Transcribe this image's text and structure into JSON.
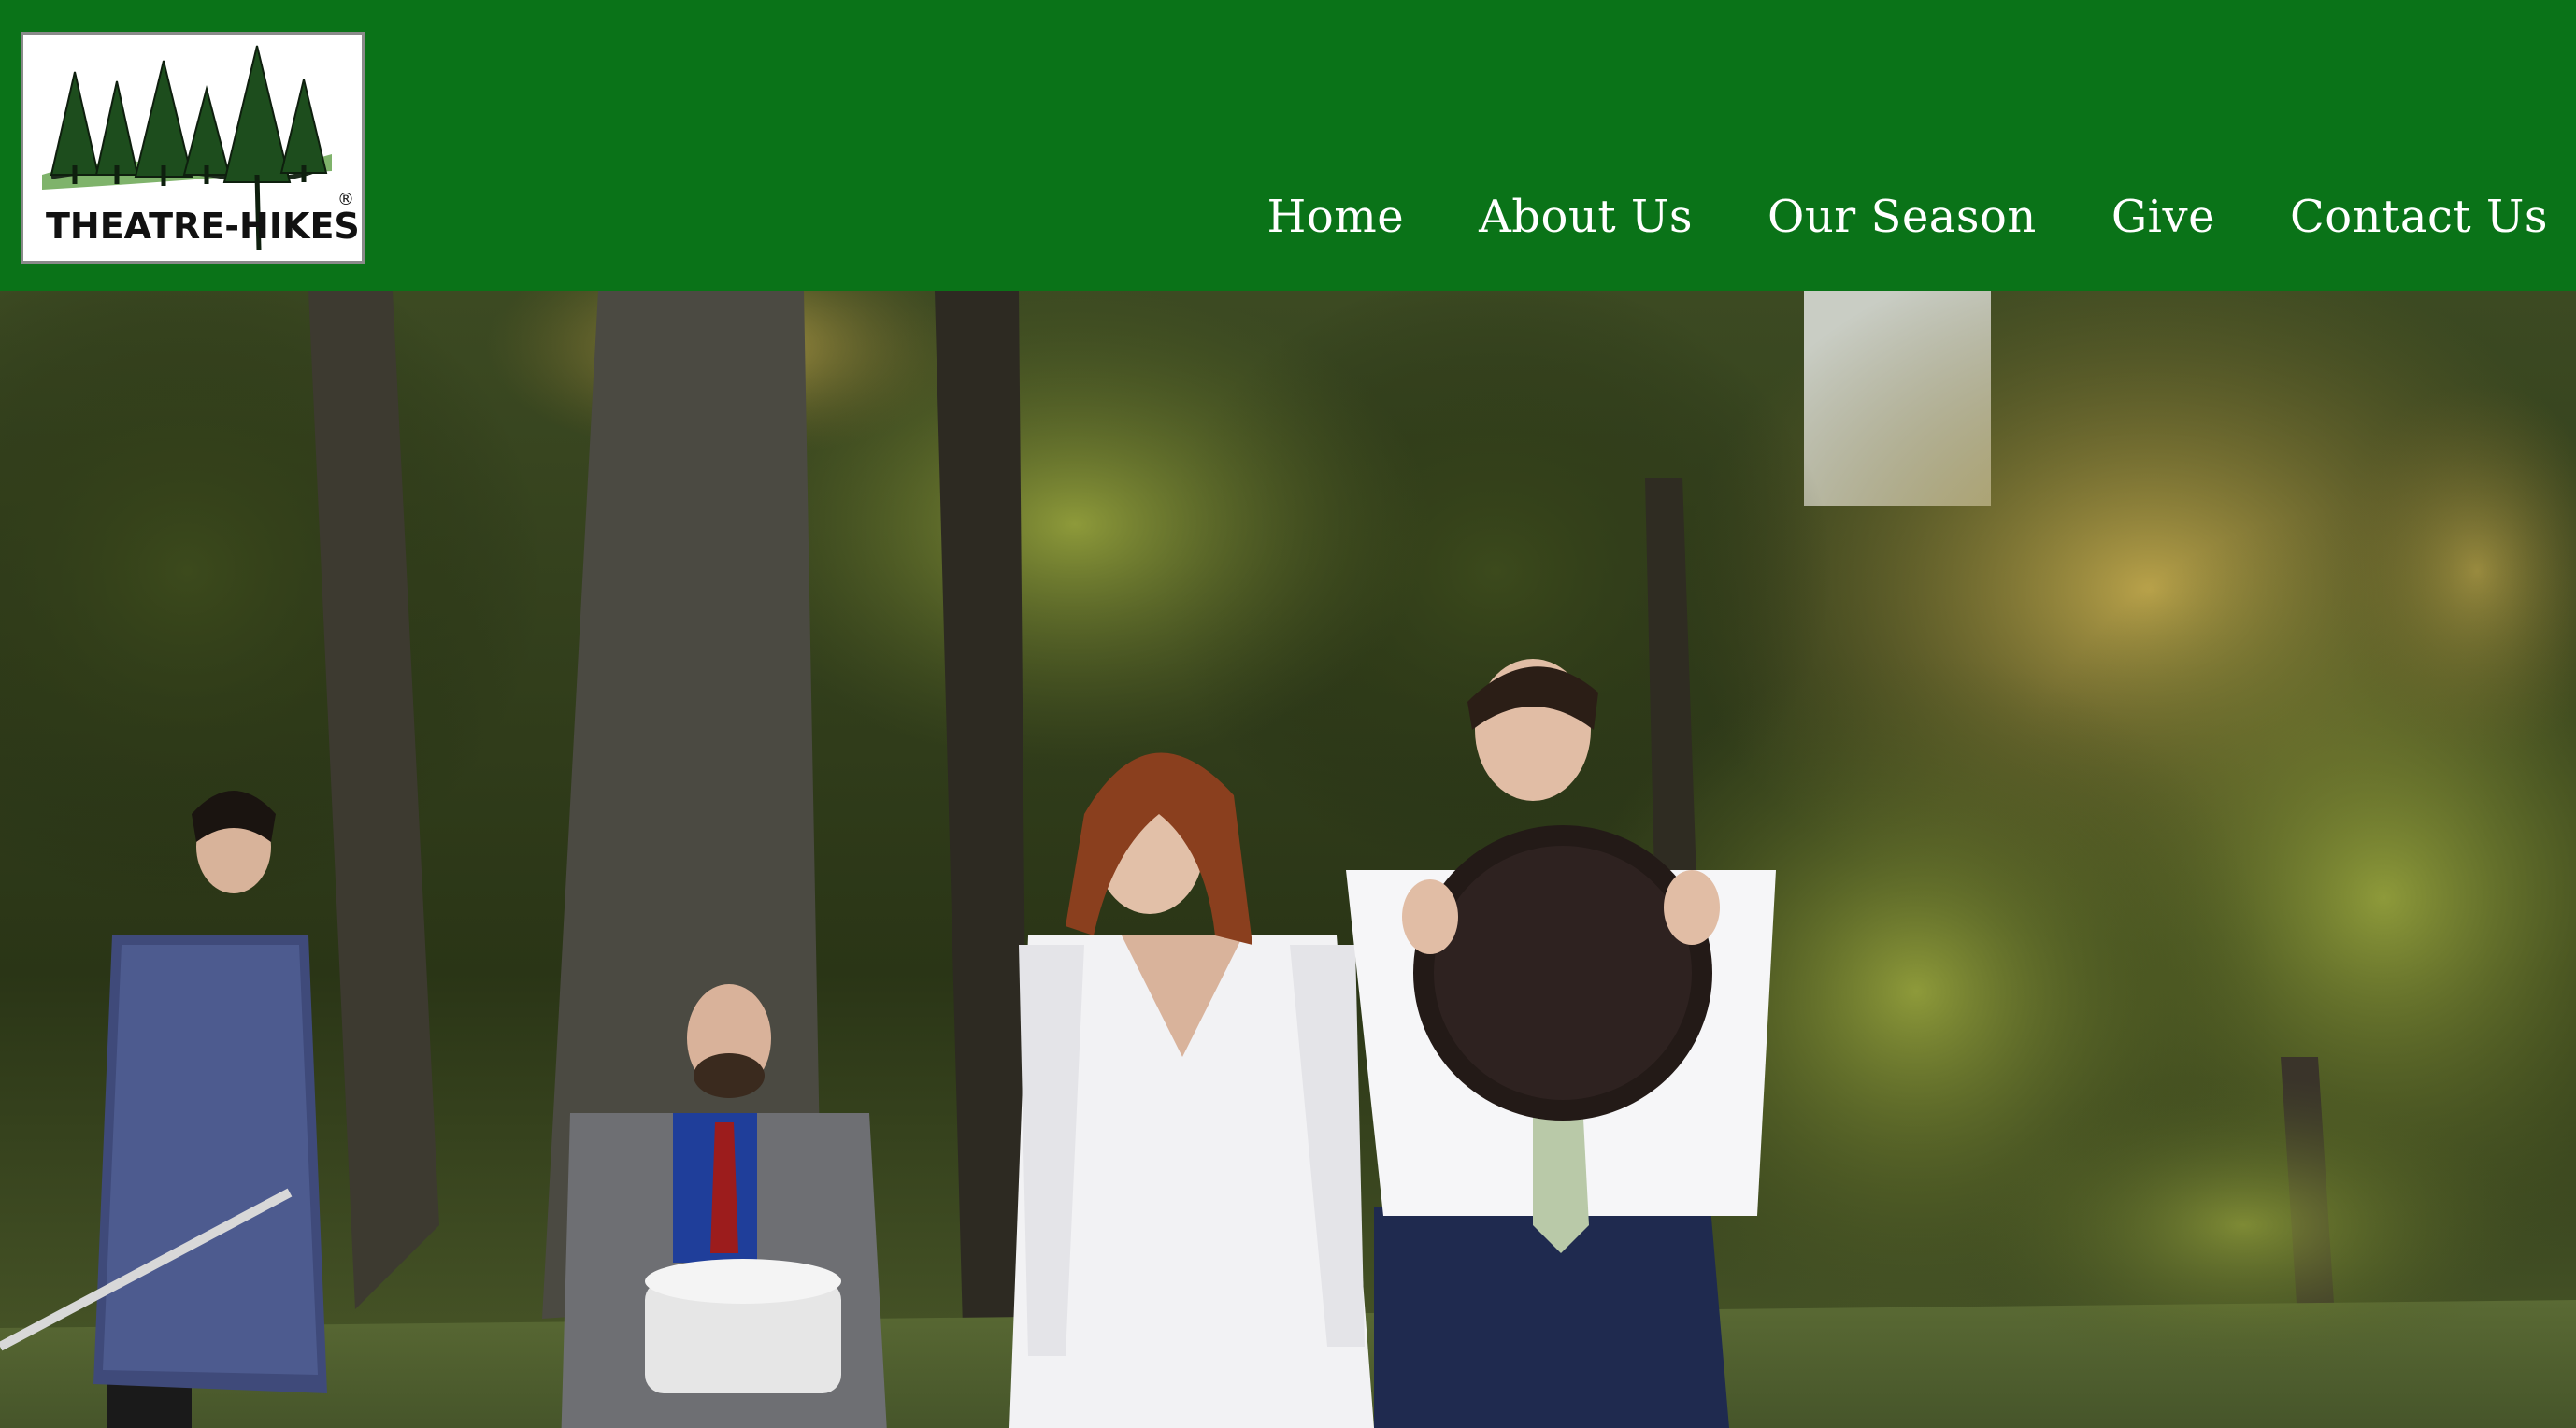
{
  "header": {
    "logo": {
      "text": "THEATRE-HIKES",
      "registered_mark": "®",
      "icon": "pine-trees-icon"
    },
    "nav": [
      {
        "label": "Home"
      },
      {
        "label": "About Us"
      },
      {
        "label": "Our Season"
      },
      {
        "label": "Give"
      },
      {
        "label": "Contact Us"
      }
    ]
  },
  "hero": {
    "description": "outdoor-theatre-cast-photo"
  },
  "colors": {
    "header_bg": "#0a7318",
    "nav_text": "#ffffff",
    "logo_bg": "#ffffff",
    "logo_tree": "#1f5a1f"
  }
}
